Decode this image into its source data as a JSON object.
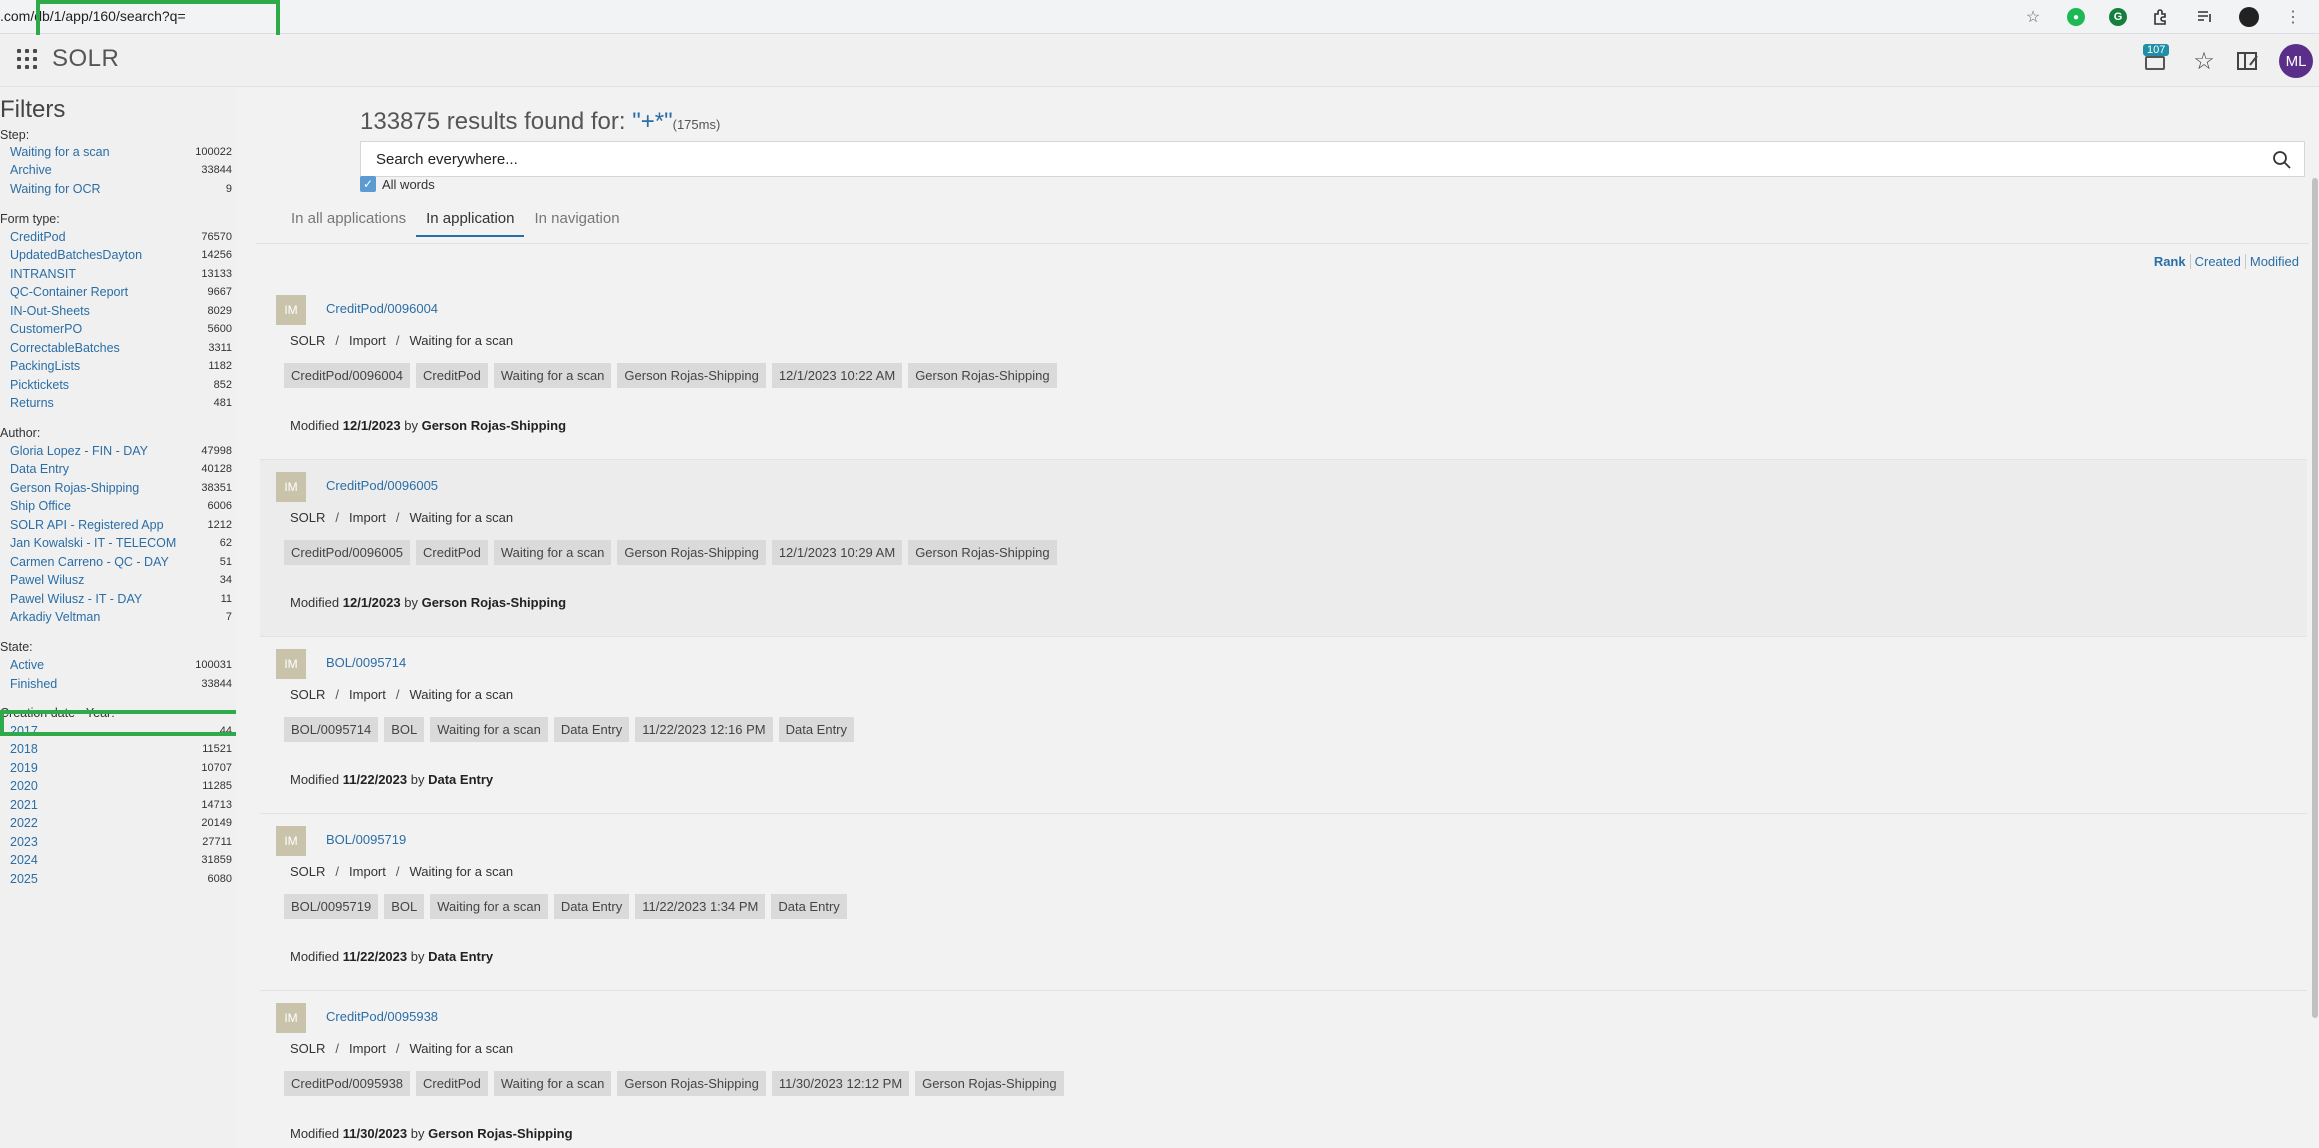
{
  "browser": {
    "url": ".com/db/1/app/160/search?q=",
    "icons": [
      "star-icon",
      "extension-green-icon",
      "grammarly-icon",
      "puzzle-icon",
      "playlist-icon",
      "profile-dark-icon",
      "more-menu-icon"
    ]
  },
  "header": {
    "app_title": "SOLR",
    "notification_count": "107",
    "avatar_initials": "ML"
  },
  "sidebar": {
    "title": "Filters",
    "groups": [
      {
        "label": "Step:",
        "items": [
          {
            "label": "Waiting for a scan",
            "count": "100022"
          },
          {
            "label": "Archive",
            "count": "33844"
          },
          {
            "label": "Waiting for OCR",
            "count": "9"
          }
        ]
      },
      {
        "label": "Form type:",
        "items": [
          {
            "label": "CreditPod",
            "count": "76570"
          },
          {
            "label": "UpdatedBatchesDayton",
            "count": "14256"
          },
          {
            "label": "INTRANSIT",
            "count": "13133"
          },
          {
            "label": "QC-Container Report",
            "count": "9667"
          },
          {
            "label": "IN-Out-Sheets",
            "count": "8029"
          },
          {
            "label": "CustomerPO",
            "count": "5600"
          },
          {
            "label": "CorrectableBatches",
            "count": "3311"
          },
          {
            "label": "PackingLists",
            "count": "1182"
          },
          {
            "label": "Picktickets",
            "count": "852"
          },
          {
            "label": "Returns",
            "count": "481"
          }
        ]
      },
      {
        "label": "Author:",
        "items": [
          {
            "label": "Gloria Lopez - FIN - DAY",
            "count": "47998"
          },
          {
            "label": "Data Entry",
            "count": "40128"
          },
          {
            "label": "Gerson Rojas-Shipping",
            "count": "38351"
          },
          {
            "label": "Ship Office",
            "count": "6006"
          },
          {
            "label": "SOLR API - Registered App",
            "count": "1212"
          },
          {
            "label": "Jan Kowalski - IT - TELECOM",
            "count": "62"
          },
          {
            "label": "Carmen Carreno - QC - DAY",
            "count": "51"
          },
          {
            "label": "Pawel Wilusz",
            "count": "34"
          },
          {
            "label": "Pawel Wilusz - IT - DAY",
            "count": "11"
          },
          {
            "label": "Arkadiy Veltman",
            "count": "7"
          }
        ]
      },
      {
        "label": "State:",
        "items": [
          {
            "label": "Active",
            "count": "100031"
          },
          {
            "label": "Finished",
            "count": "33844"
          }
        ]
      },
      {
        "label": "Creation date - Year:",
        "items": [
          {
            "label": "2017",
            "count": "44"
          },
          {
            "label": "2018",
            "count": "11521"
          },
          {
            "label": "2019",
            "count": "10707"
          },
          {
            "label": "2020",
            "count": "11285"
          },
          {
            "label": "2021",
            "count": "14713"
          },
          {
            "label": "2022",
            "count": "20149"
          },
          {
            "label": "2023",
            "count": "27711"
          },
          {
            "label": "2024",
            "count": "31859"
          },
          {
            "label": "2025",
            "count": "6080"
          }
        ]
      }
    ]
  },
  "main": {
    "results_count": "133875",
    "results_text": "results found for:",
    "query": "\"+*\"",
    "timing": "(175ms)",
    "search_placeholder": "Search everywhere...",
    "all_words_label": "All words",
    "all_words_checked": true,
    "tabs": [
      {
        "label": "In all applications",
        "active": false
      },
      {
        "label": "In application",
        "active": true
      },
      {
        "label": "In navigation",
        "active": false
      }
    ],
    "sort": [
      "Rank",
      "Created",
      "Modified"
    ],
    "results": [
      {
        "icon_text": "IM",
        "title": "CreditPod/0096004",
        "path": [
          "SOLR",
          "Import",
          "Waiting for a scan"
        ],
        "tags": [
          "CreditPod/0096004",
          "CreditPod",
          "Waiting for a scan",
          "Gerson Rojas-Shipping",
          "12/1/2023 10:22 AM",
          "Gerson Rojas-Shipping"
        ],
        "modified_prefix": "Modified",
        "modified_date": "12/1/2023",
        "by": "by",
        "modified_by": "Gerson Rojas-Shipping"
      },
      {
        "icon_text": "IM",
        "title": "CreditPod/0096005",
        "path": [
          "SOLR",
          "Import",
          "Waiting for a scan"
        ],
        "tags": [
          "CreditPod/0096005",
          "CreditPod",
          "Waiting for a scan",
          "Gerson Rojas-Shipping",
          "12/1/2023 10:29 AM",
          "Gerson Rojas-Shipping"
        ],
        "modified_prefix": "Modified",
        "modified_date": "12/1/2023",
        "by": "by",
        "modified_by": "Gerson Rojas-Shipping"
      },
      {
        "icon_text": "IM",
        "title": "BOL/0095714",
        "path": [
          "SOLR",
          "Import",
          "Waiting for a scan"
        ],
        "tags": [
          "BOL/0095714",
          "BOL",
          "Waiting for a scan",
          "Data Entry",
          "11/22/2023 12:16 PM",
          "Data Entry"
        ],
        "modified_prefix": "Modified",
        "modified_date": "11/22/2023",
        "by": "by",
        "modified_by": "Data Entry"
      },
      {
        "icon_text": "IM",
        "title": "BOL/0095719",
        "path": [
          "SOLR",
          "Import",
          "Waiting for a scan"
        ],
        "tags": [
          "BOL/0095719",
          "BOL",
          "Waiting for a scan",
          "Data Entry",
          "11/22/2023 1:34 PM",
          "Data Entry"
        ],
        "modified_prefix": "Modified",
        "modified_date": "11/22/2023",
        "by": "by",
        "modified_by": "Data Entry"
      },
      {
        "icon_text": "IM",
        "title": "CreditPod/0095938",
        "path": [
          "SOLR",
          "Import",
          "Waiting for a scan"
        ],
        "tags": [
          "CreditPod/0095938",
          "CreditPod",
          "Waiting for a scan",
          "Gerson Rojas-Shipping",
          "11/30/2023 12:12 PM",
          "Gerson Rojas-Shipping"
        ],
        "modified_prefix": "Modified",
        "modified_date": "11/30/2023",
        "by": "by",
        "modified_by": "Gerson Rojas-Shipping"
      }
    ]
  },
  "colors": {
    "link": "#2a6ea6",
    "highlight_box": "#2eaa4a",
    "avatar_bg": "#5b2e8a",
    "badge_bg": "#1f8fa8",
    "tag_bg": "#dadada",
    "im_icon_bg": "#c9c3ac"
  }
}
